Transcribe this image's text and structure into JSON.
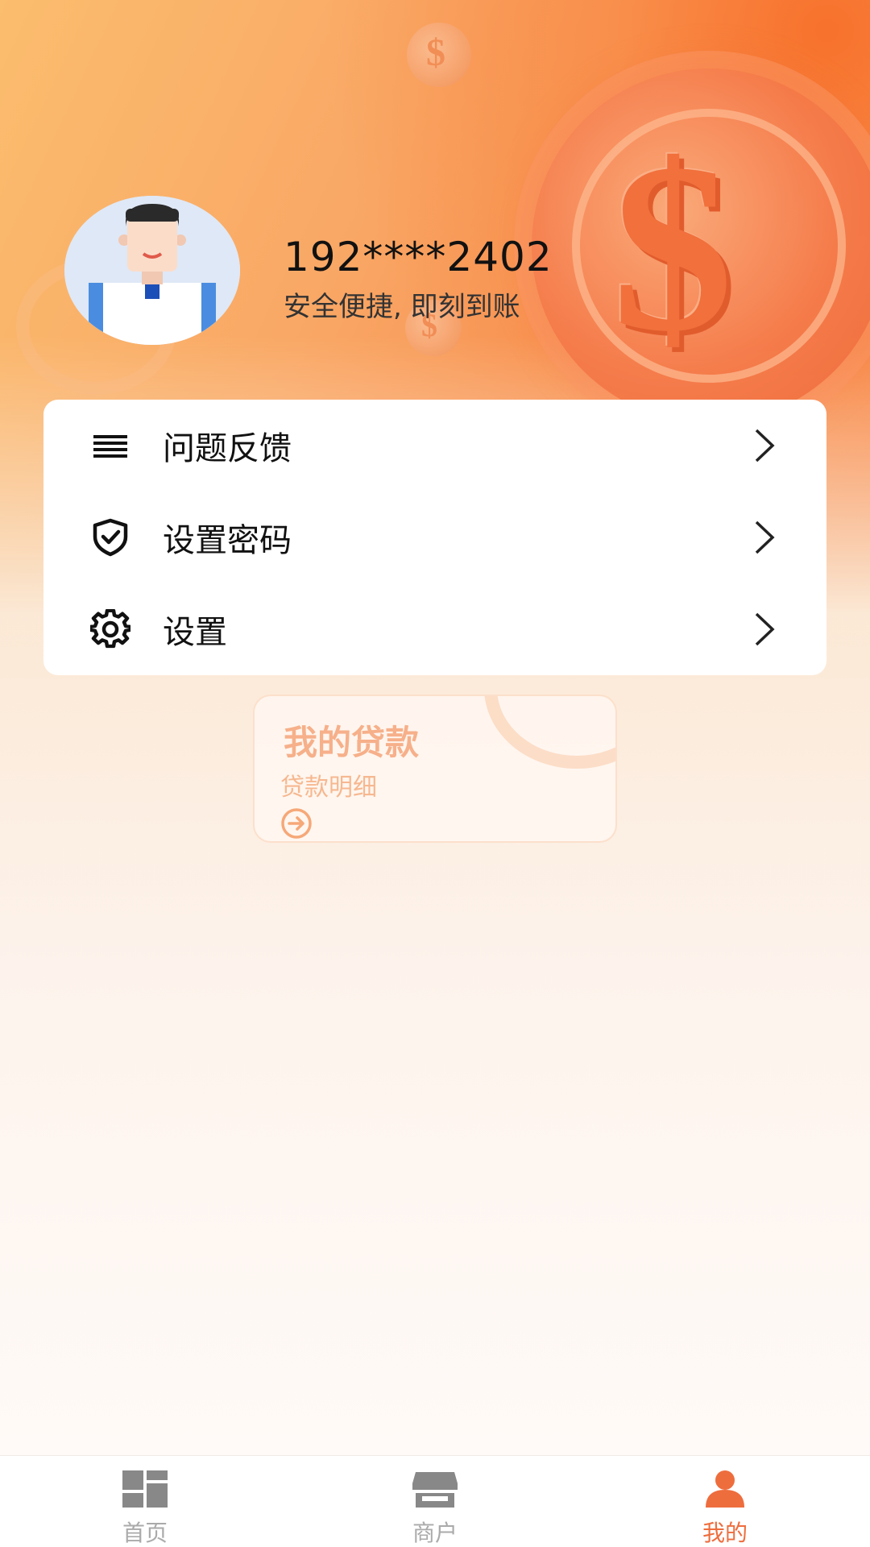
{
  "profile": {
    "phone": "192****2402",
    "slogan": "安全便捷, 即刻到账"
  },
  "menu": {
    "items": [
      {
        "label": "问题反馈",
        "icon": "list-icon"
      },
      {
        "label": "设置密码",
        "icon": "shield-check-icon"
      },
      {
        "label": "设置",
        "icon": "gear-icon"
      }
    ]
  },
  "loan_card": {
    "title": "我的贷款",
    "subtitle": "贷款明细",
    "icon": "arrow-right-circle-icon"
  },
  "bottom_nav": {
    "items": [
      {
        "label": "首页",
        "icon": "dashboard-icon",
        "active": false
      },
      {
        "label": "商户",
        "icon": "store-icon",
        "active": false
      },
      {
        "label": "我的",
        "icon": "person-icon",
        "active": true
      }
    ]
  },
  "colors": {
    "accent": "#ee6d3d",
    "header_orange": "#f77d3e",
    "inactive_nav": "#aaaaaa"
  }
}
